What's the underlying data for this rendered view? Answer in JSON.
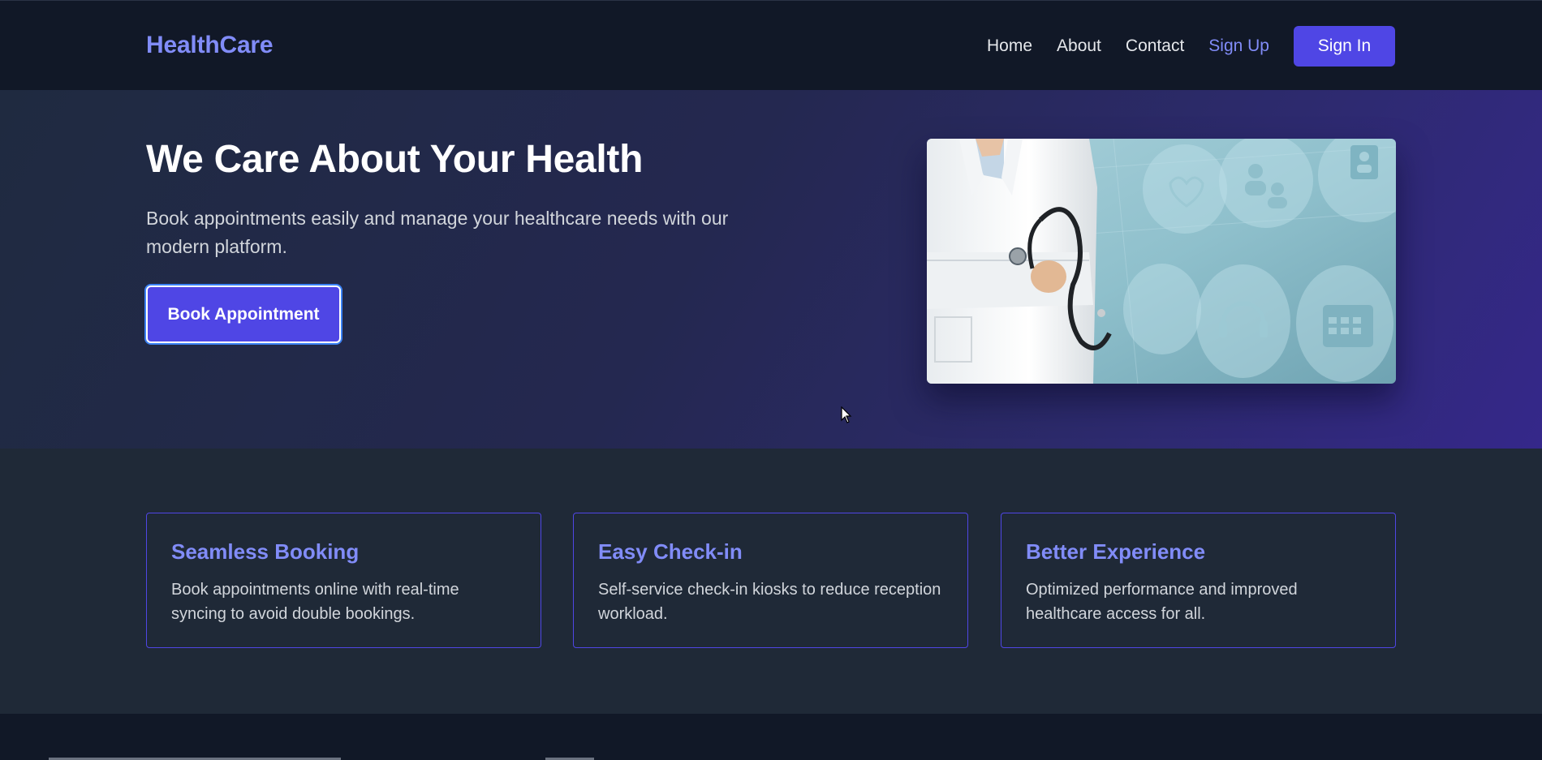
{
  "header": {
    "brand": "HealthCare",
    "nav": {
      "home": "Home",
      "about": "About",
      "contact": "Contact",
      "signup": "Sign Up",
      "signin": "Sign In"
    }
  },
  "hero": {
    "title": "We Care About Your Health",
    "subtitle": "Book appointments easily and manage your healthcare needs with our modern platform.",
    "cta": "Book Appointment",
    "image_icon": "doctor-with-stethoscope-image"
  },
  "features": [
    {
      "title": "Seamless Booking",
      "text": "Book appointments online with real-time syncing to avoid double bookings."
    },
    {
      "title": "Easy Check-in",
      "text": "Self-service check-in kiosks to reduce reception workload."
    },
    {
      "title": "Better Experience",
      "text": "Optimized performance and improved healthcare access for all."
    }
  ],
  "colors": {
    "accent": "#818cf8",
    "primary_button": "#4f46e5",
    "header_bg": "#111827",
    "body_bg": "#1f2937"
  }
}
